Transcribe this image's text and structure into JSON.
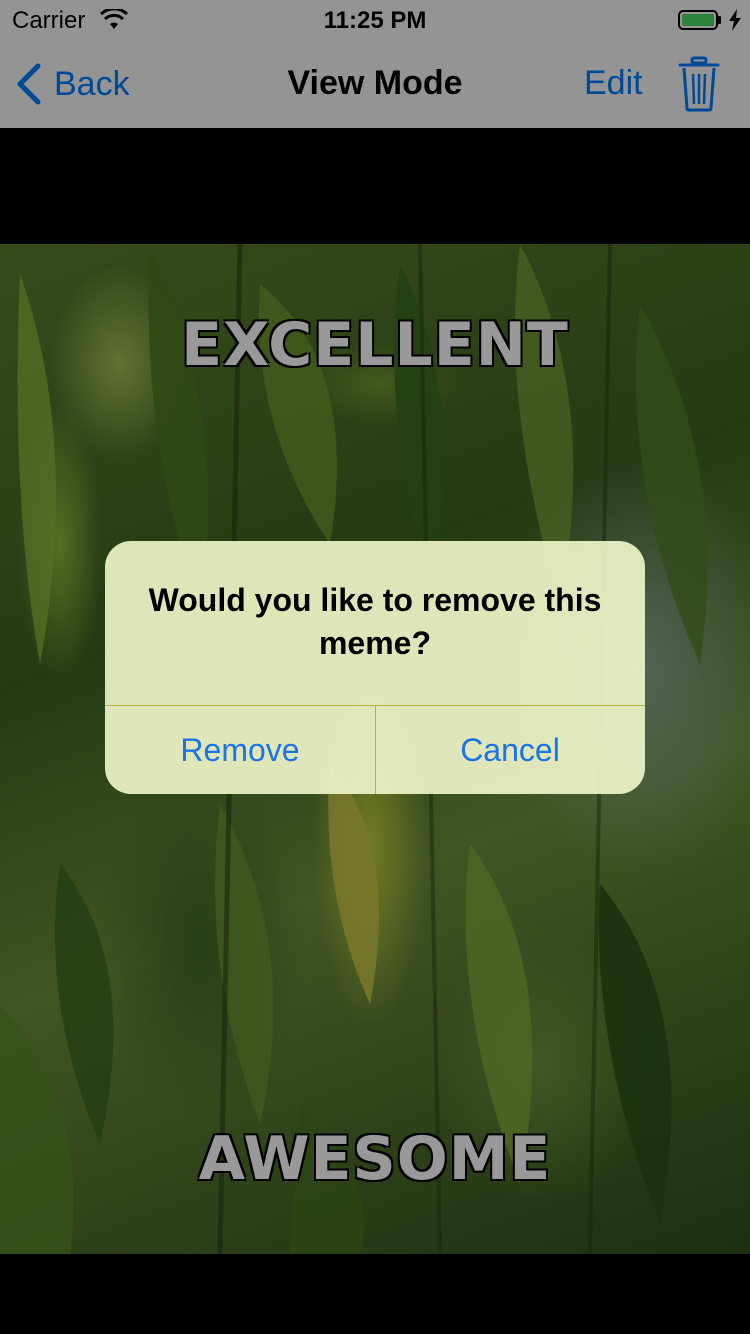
{
  "status_bar": {
    "carrier": "Carrier",
    "time": "11:25 PM",
    "battery_color": "#4cd964"
  },
  "nav": {
    "back_label": "Back",
    "title": "View Mode",
    "edit_label": "Edit",
    "trash_icon": "trash-icon"
  },
  "meme": {
    "top_text": "EXCELLENT",
    "bottom_text": "AWESOME"
  },
  "alert": {
    "message": "Would you like to remove this meme?",
    "remove_label": "Remove",
    "cancel_label": "Cancel"
  },
  "colors": {
    "accent": "#007aff",
    "nav_background": "#f7f7f7"
  }
}
